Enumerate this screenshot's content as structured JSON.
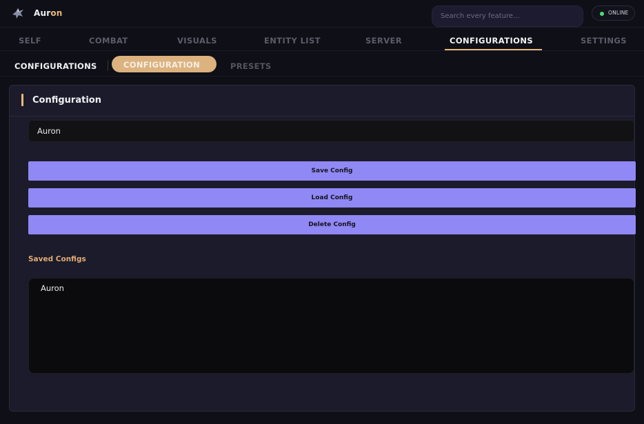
{
  "app": {
    "brand_part1": "Aur",
    "brand_part2": "on",
    "logo_icon": "raven-logo-icon"
  },
  "search": {
    "placeholder": "Search every feature..."
  },
  "status": {
    "label": "ONLINE",
    "color": "#4cd97b"
  },
  "tabs": [
    {
      "label": "SELF",
      "active": false
    },
    {
      "label": "COMBAT",
      "active": false
    },
    {
      "label": "VISUALS",
      "active": false
    },
    {
      "label": "ENTITY LIST",
      "active": false
    },
    {
      "label": "SERVER",
      "active": false
    },
    {
      "label": "CONFIGURATIONS",
      "active": true
    },
    {
      "label": "SETTINGS",
      "active": false
    }
  ],
  "subtabs": {
    "section_title": "CONFIGURATIONS",
    "items": [
      {
        "label": "CONFIGURATION",
        "active": true
      },
      {
        "label": "PRESETS",
        "active": false
      }
    ]
  },
  "panel": {
    "title": "Configuration",
    "config_name_value": "Auron",
    "buttons": {
      "save": "Save Config",
      "load": "Load Config",
      "delete": "Delete Config"
    },
    "saved_label": "Saved Configs",
    "saved_items": [
      "Auron"
    ]
  },
  "colors": {
    "accent": "#e9b97a",
    "button": "#9088f4",
    "background": "#0f0f17",
    "panel": "#1c1b2b"
  }
}
